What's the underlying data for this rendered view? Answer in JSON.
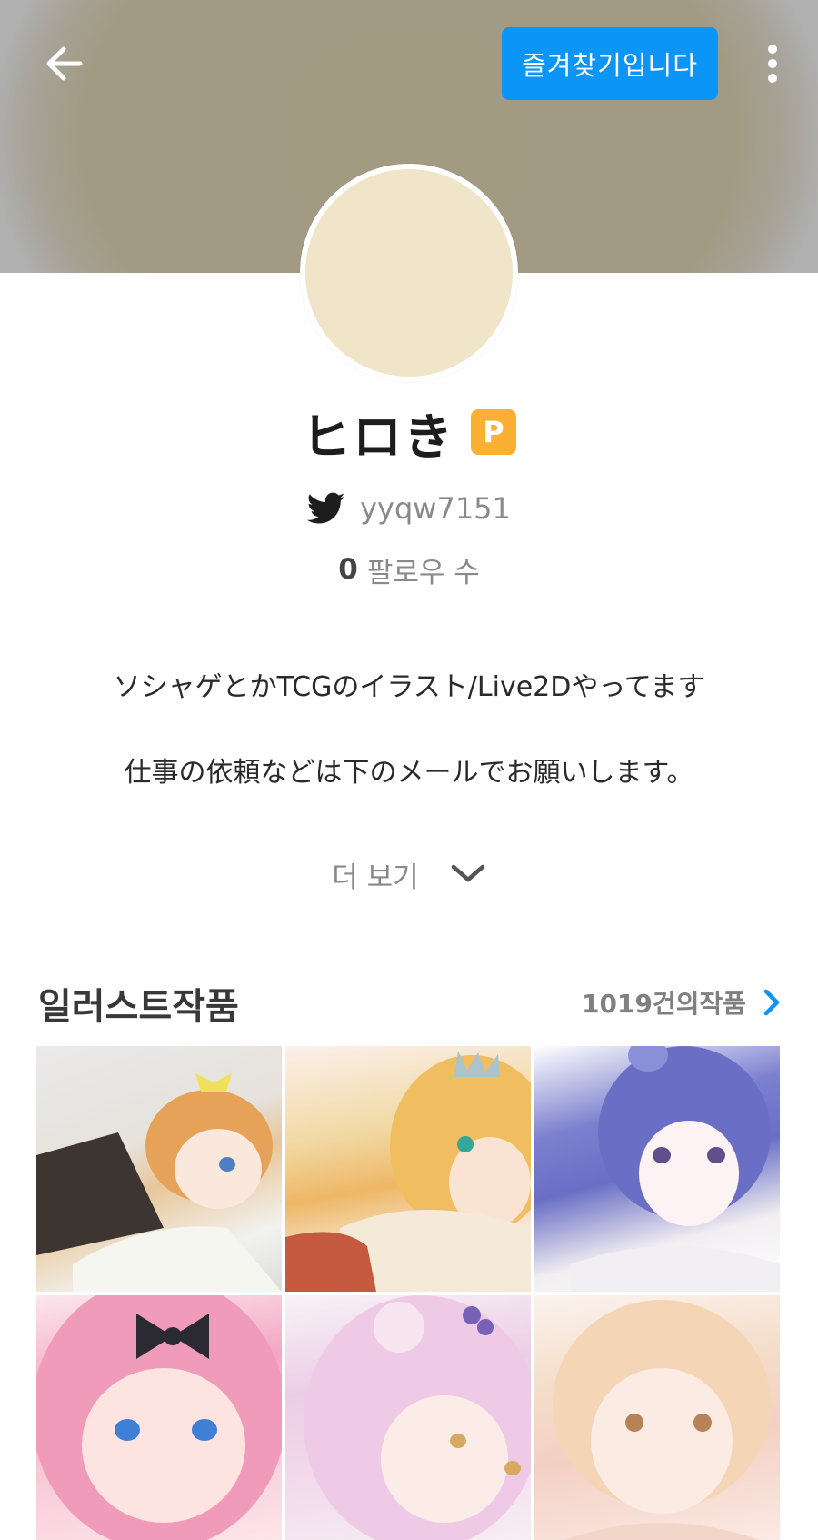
{
  "header": {
    "back_icon": "arrow-left-icon",
    "follow_label": "즐겨찾기입니다",
    "more_icon": "more-vertical-icon",
    "accent_color": "#0b96f7"
  },
  "profile": {
    "name": "ヒロき",
    "premium_badge": "P",
    "twitter_icon": "twitter-bird-icon",
    "twitter_handle": "yyqw7151",
    "followers_count": "0",
    "followers_label": "팔로우 수",
    "bio": [
      "ソシャゲとかTCGのイラスト/Live2Dやってます",
      "仕事の依頼などは下のメールでお願いします。"
    ],
    "more_label": "더 보기"
  },
  "works": {
    "section_title": "일러스트작품",
    "count_label": "1019건의작품",
    "thumbnails": [
      "illustration-1",
      "illustration-2",
      "illustration-3",
      "illustration-4",
      "illustration-5",
      "illustration-6"
    ]
  }
}
